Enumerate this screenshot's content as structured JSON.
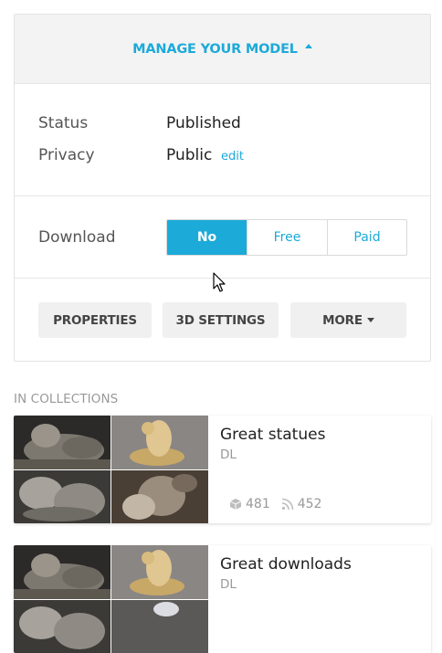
{
  "manage": {
    "title": "MANAGE YOUR MODEL",
    "status_label": "Status",
    "status_value": "Published",
    "privacy_label": "Privacy",
    "privacy_value": "Public",
    "edit_label": "edit",
    "download_label": "Download",
    "download_options": [
      "No",
      "Free",
      "Paid"
    ],
    "download_selected": "No",
    "buttons": {
      "properties": "PROPERTIES",
      "settings_3d": "3D SETTINGS",
      "more": "MORE"
    }
  },
  "collections": {
    "heading": "IN COLLECTIONS",
    "items": [
      {
        "title": "Great statues",
        "author": "DL",
        "models_count": "481",
        "followers_count": "452"
      },
      {
        "title": "Great downloads",
        "author": "DL"
      }
    ]
  },
  "colors": {
    "accent": "#1caad9",
    "panel_header_bg": "#f3f3f3",
    "button_bg": "#f0f0f0",
    "muted_text": "#999999"
  },
  "icons": {
    "manage_caret": "caret-up-icon",
    "more_caret": "caret-down-icon",
    "models_count": "cube-icon",
    "followers_count": "rss-icon"
  }
}
